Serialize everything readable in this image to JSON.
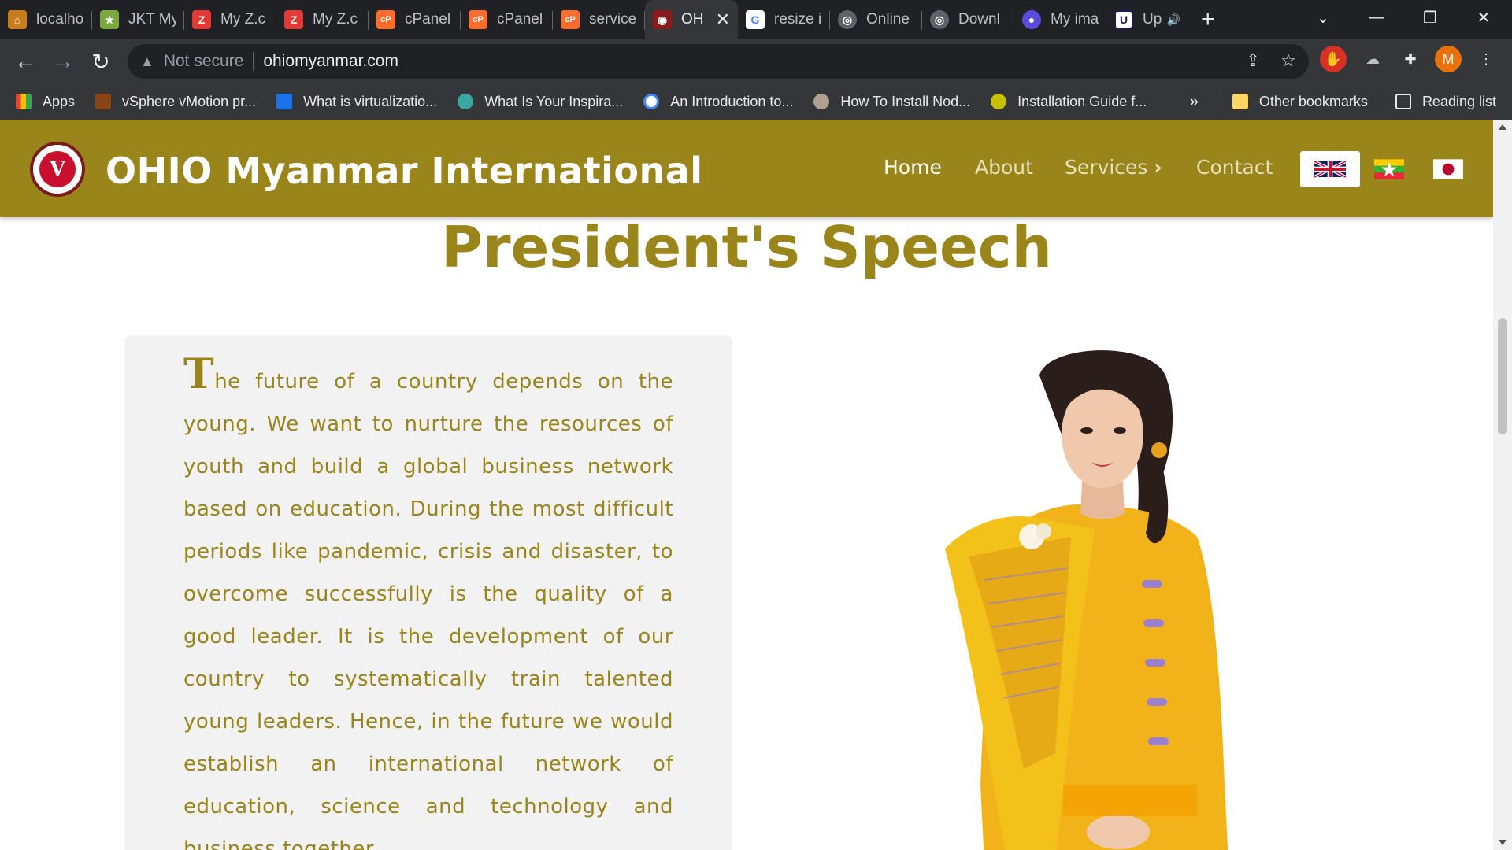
{
  "browser": {
    "tabs": [
      {
        "title": "localho",
        "fav_color": "#c77d1a",
        "fav_glyph": "⌂"
      },
      {
        "title": "JKT My",
        "fav_color": "#7aa83c",
        "fav_glyph": "★"
      },
      {
        "title": "My Z.c",
        "fav_color": "#e53935",
        "fav_glyph": "Z"
      },
      {
        "title": "My Z.c",
        "fav_color": "#e53935",
        "fav_glyph": "Z"
      },
      {
        "title": "cPanel",
        "fav_color": "#ff6c2c",
        "fav_glyph": "cP"
      },
      {
        "title": "cPanel",
        "fav_color": "#ff6c2c",
        "fav_glyph": "cP"
      },
      {
        "title": "service",
        "fav_color": "#ff6c2c",
        "fav_glyph": "cP"
      },
      {
        "title": "OH",
        "fav_color": "#8b1a1a",
        "fav_glyph": "◉"
      },
      {
        "title": "resize i",
        "fav_color": "#4285f4",
        "fav_glyph": "G"
      },
      {
        "title": "Online",
        "fav_color": "#5f6368",
        "fav_glyph": "◎"
      },
      {
        "title": "Downl",
        "fav_color": "#5f6368",
        "fav_glyph": "◎"
      },
      {
        "title": "My ima",
        "fav_color": "#5b4bdb",
        "fav_glyph": "●"
      },
      {
        "title": "Up",
        "fav_color": "#1a1a60",
        "fav_glyph": "U"
      }
    ],
    "active_tab_index": 7,
    "new_tab_label": "+",
    "security_label": "Not secure",
    "url": "ohiomyanmar.com",
    "profile_initial": "M",
    "bookmarks": [
      {
        "label": "Apps",
        "color": "#ea4335"
      },
      {
        "label": "vSphere vMotion pr...",
        "color": "#8b4513"
      },
      {
        "label": "What is virtualizatio...",
        "color": "#1a73e8"
      },
      {
        "label": "What Is Your Inspira...",
        "color": "#3aa8a0"
      },
      {
        "label": "An Introduction to...",
        "color": "#4285f4"
      },
      {
        "label": "How To Install Nod...",
        "color": "#b0a090"
      },
      {
        "label": "Installation Guide f...",
        "color": "#c7c000"
      }
    ],
    "bookmarks_overflow": "»",
    "other_bookmarks": "Other bookmarks",
    "reading_list": "Reading list"
  },
  "site": {
    "brand": "OHIO Myanmar International",
    "nav": {
      "home": "Home",
      "about": "About",
      "services": "Services",
      "contact": "Contact"
    },
    "languages": [
      "English",
      "Myanmar",
      "Japanese"
    ],
    "selected_language": "English",
    "header_color": "#9a851a"
  },
  "speech": {
    "title": "President's Speech",
    "dropcap": "T",
    "body": "he future of a country depends on the young. We want to nurture the resources of youth and build a global business network based on education. During the most difficult periods like pandemic, crisis and disaster, to overcome successfully is the quality of a good leader. It is the development of our country to systematically train talented young leaders. Hence, in the future we would establish an international network of education, science and technology and business together."
  }
}
